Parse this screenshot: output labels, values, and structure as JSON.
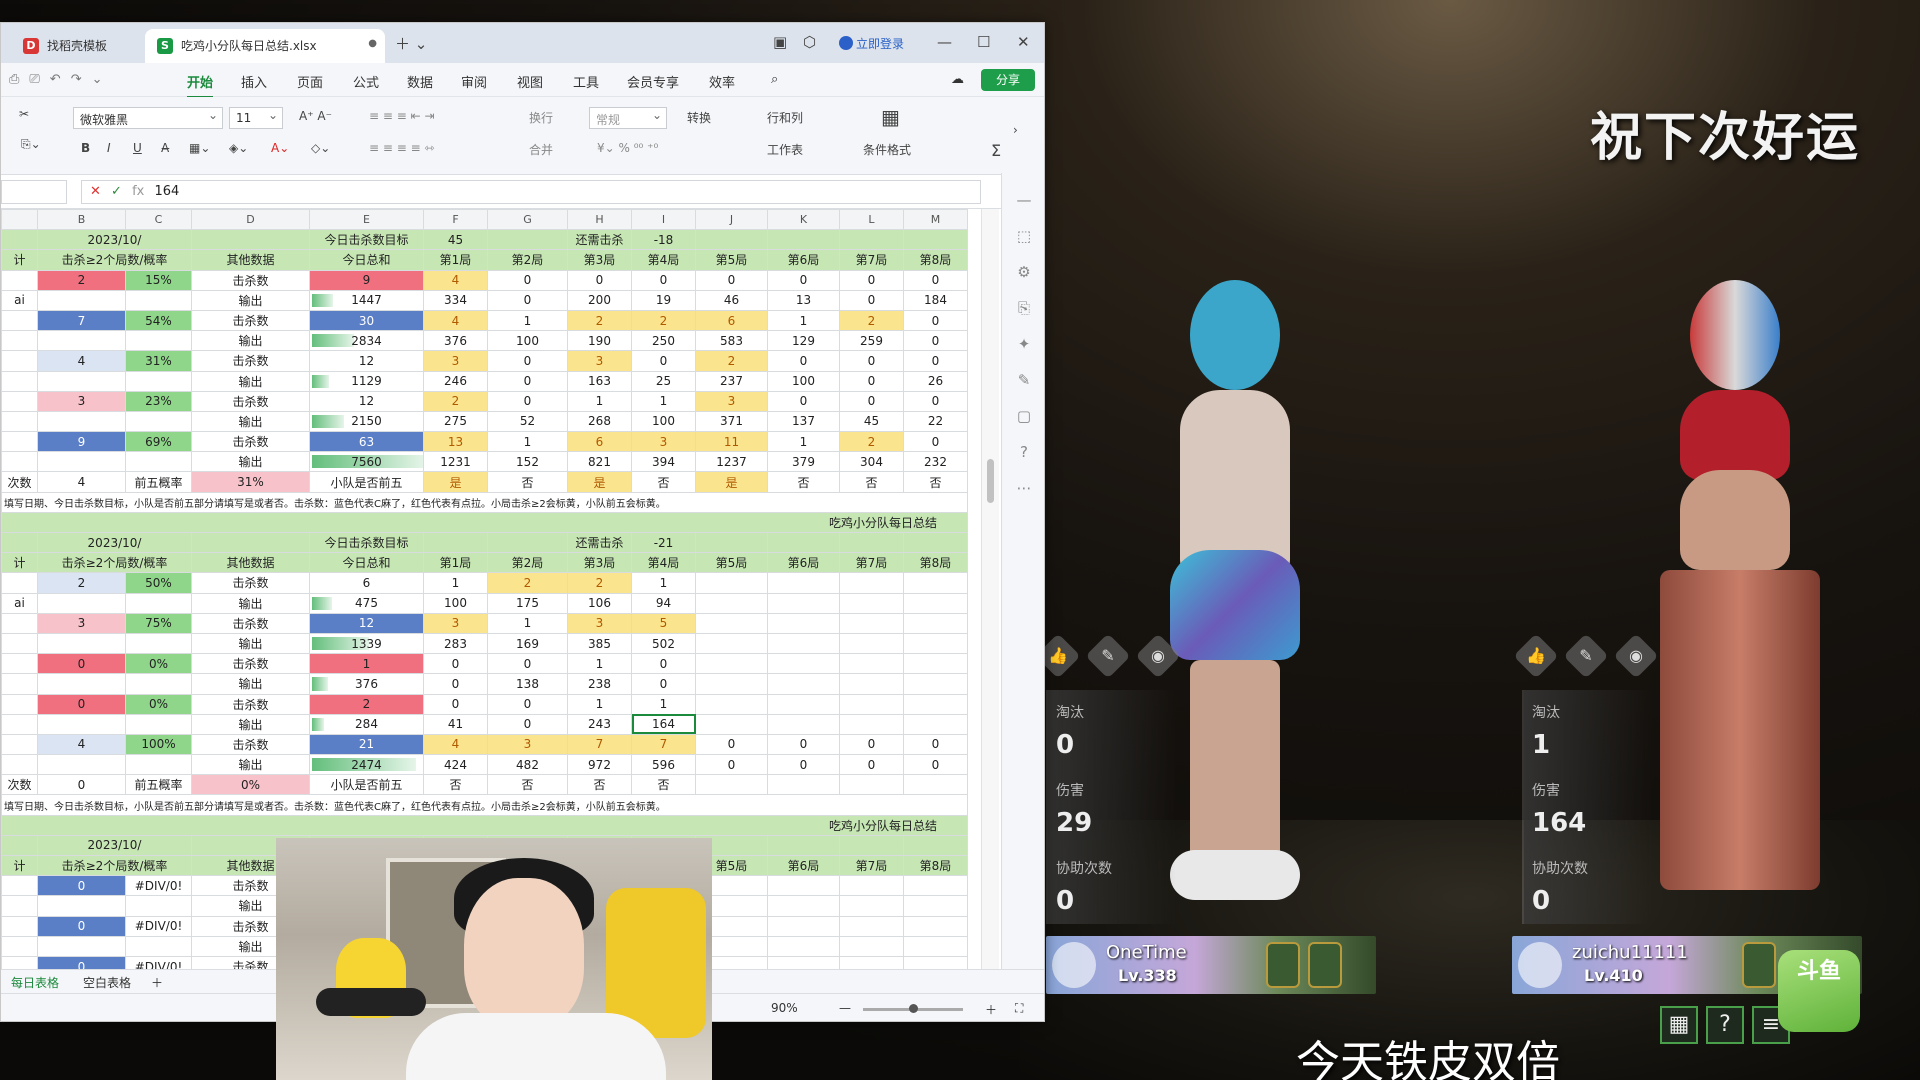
{
  "game": {
    "blessing": "祝下次好运",
    "subtitle": "今天铁皮双倍",
    "players": [
      {
        "stats": [
          {
            "label": "淘汰",
            "value": "0"
          },
          {
            "label": "伤害",
            "value": "29"
          },
          {
            "label": "协助次数",
            "value": "0"
          }
        ],
        "card_name": "OneTime",
        "card_level": "Lv.338"
      },
      {
        "stats": [
          {
            "label": "淘汰",
            "value": "1"
          },
          {
            "label": "伤害",
            "value": "164"
          },
          {
            "label": "协助次数",
            "value": "0"
          }
        ],
        "card_name": "zuichu11111",
        "card_level": "Lv.410"
      }
    ],
    "watermark": "斗鱼",
    "help_symbol": "?"
  },
  "app": {
    "tabs": [
      {
        "label": "找稻壳模板",
        "icon": "wps-icon",
        "color": "#d93636"
      },
      {
        "label": "吃鸡小分队每日总结.xlsx",
        "icon": "sheet-icon",
        "color": "#1b9a46"
      }
    ],
    "login": "立即登录",
    "menu": [
      "开始",
      "插入",
      "页面",
      "公式",
      "数据",
      "审阅",
      "视图",
      "工具",
      "会员专享",
      "效率"
    ],
    "share": "分享",
    "ribbon": {
      "font": "微软雅黑",
      "size": "11",
      "wrap": "换行",
      "merge": "合并",
      "format": "常规",
      "convert": "转换",
      "rowcol": "行和列",
      "worksheet": "工作表",
      "condfmt": "条件格式"
    },
    "formula": {
      "value": "164"
    },
    "columns": [
      "B",
      "C",
      "D",
      "E",
      "F",
      "G",
      "H",
      "I",
      "J",
      "K",
      "L",
      "M"
    ],
    "sheet_tabs": [
      "每日表格",
      "空白表格"
    ],
    "zoom": "90%"
  },
  "sheet": {
    "block1": {
      "r1": [
        "2023/10/",
        "今日击杀数目标",
        "45",
        "还需击杀",
        "-18"
      ],
      "r2": [
        "击杀≥2个局数/概率",
        "其他数据",
        "今日总和",
        "第1局",
        "第2局",
        "第3局",
        "第4局",
        "第5局",
        "第6局",
        "第7局",
        "第8局"
      ],
      "rows": [
        [
          "2",
          "15%",
          "击杀数",
          "9",
          "4",
          "0",
          "0",
          "0",
          "0",
          "0",
          "0",
          "0"
        ],
        [
          "",
          "",
          "输出",
          "1447",
          "334",
          "0",
          "200",
          "19",
          "46",
          "13",
          "0",
          "184"
        ],
        [
          "7",
          "54%",
          "击杀数",
          "30",
          "4",
          "1",
          "2",
          "2",
          "6",
          "1",
          "2",
          "0"
        ],
        [
          "",
          "",
          "输出",
          "2834",
          "376",
          "100",
          "190",
          "250",
          "583",
          "129",
          "259",
          "0"
        ],
        [
          "4",
          "31%",
          "击杀数",
          "12",
          "3",
          "0",
          "3",
          "0",
          "2",
          "0",
          "0",
          "0"
        ],
        [
          "",
          "",
          "输出",
          "1129",
          "246",
          "0",
          "163",
          "25",
          "237",
          "100",
          "0",
          "26"
        ],
        [
          "3",
          "23%",
          "击杀数",
          "12",
          "2",
          "0",
          "1",
          "1",
          "3",
          "0",
          "0",
          "0"
        ],
        [
          "",
          "",
          "输出",
          "2150",
          "275",
          "52",
          "268",
          "100",
          "371",
          "137",
          "45",
          "22"
        ],
        [
          "9",
          "69%",
          "击杀数",
          "63",
          "13",
          "1",
          "6",
          "3",
          "11",
          "1",
          "2",
          "0"
        ],
        [
          "",
          "",
          "输出",
          "7560",
          "1231",
          "152",
          "821",
          "394",
          "1237",
          "379",
          "304",
          "232"
        ],
        [
          "4",
          "前五概率",
          "31%",
          "小队是否前五",
          "是",
          "否",
          "是",
          "否",
          "是",
          "否",
          "否",
          "否"
        ]
      ],
      "note": "填写日期、今日击杀数目标，小队是否前五部分请填写是或者否。击杀数：蓝色代表C麻了，红色代表有点拉。小局击杀≥2会标黄，小队前五会标黄。"
    },
    "block2": {
      "title": "吃鸡小分队每日总结",
      "r1": [
        "2023/10/",
        "今日击杀数目标",
        "还需击杀",
        "-21"
      ],
      "r2": [
        "击杀≥2个局数/概率",
        "其他数据",
        "今日总和",
        "第1局",
        "第2局",
        "第3局",
        "第4局",
        "第5局",
        "第6局",
        "第7局",
        "第8局"
      ],
      "rows": [
        [
          "2",
          "50%",
          "击杀数",
          "6",
          "1",
          "2",
          "2",
          "1",
          "",
          "",
          "",
          ""
        ],
        [
          "",
          "",
          "输出",
          "475",
          "100",
          "175",
          "106",
          "94",
          "",
          "",
          "",
          ""
        ],
        [
          "3",
          "75%",
          "击杀数",
          "12",
          "3",
          "1",
          "3",
          "5",
          "",
          "",
          "",
          ""
        ],
        [
          "",
          "",
          "输出",
          "1339",
          "283",
          "169",
          "385",
          "502",
          "",
          "",
          "",
          ""
        ],
        [
          "0",
          "0%",
          "击杀数",
          "1",
          "0",
          "0",
          "1",
          "0",
          "",
          "",
          "",
          ""
        ],
        [
          "",
          "",
          "输出",
          "376",
          "0",
          "138",
          "238",
          "0",
          "",
          "",
          "",
          ""
        ],
        [
          "0",
          "0%",
          "击杀数",
          "2",
          "0",
          "0",
          "1",
          "1",
          "",
          "",
          "",
          ""
        ],
        [
          "",
          "",
          "输出",
          "284",
          "41",
          "0",
          "243",
          "164",
          "",
          "",
          "",
          ""
        ],
        [
          "4",
          "100%",
          "击杀数",
          "21",
          "4",
          "3",
          "7",
          "7",
          "0",
          "0",
          "0",
          "0"
        ],
        [
          "",
          "",
          "输出",
          "2474",
          "424",
          "482",
          "972",
          "596",
          "0",
          "0",
          "0",
          "0"
        ],
        [
          "0",
          "前五概率",
          "0%",
          "小队是否前五",
          "否",
          "否",
          "否",
          "否",
          "",
          "",
          "",
          ""
        ]
      ],
      "note": "填写日期、今日击杀数目标，小队是否前五部分请填写是或者否。击杀数：蓝色代表C麻了，红色代表有点拉。小局击杀≥2会标黄，小队前五会标黄。"
    },
    "block3": {
      "title": "吃鸡小分队每日总结",
      "r1": [
        "2023/10/"
      ],
      "r2": [
        "击杀≥2个局数/概率",
        "其他数据",
        "第5局",
        "第6局",
        "第7局",
        "第8局"
      ],
      "rows": [
        [
          "0",
          "#DIV/0!",
          "击杀数"
        ],
        [
          "",
          "",
          "输出"
        ],
        [
          "0",
          "#DIV/0!",
          "击杀数"
        ],
        [
          "",
          "",
          "输出"
        ],
        [
          "0",
          "#DIV/0!",
          "击杀数"
        ]
      ]
    },
    "left_edge": [
      "计",
      "ai",
      "次数"
    ]
  }
}
